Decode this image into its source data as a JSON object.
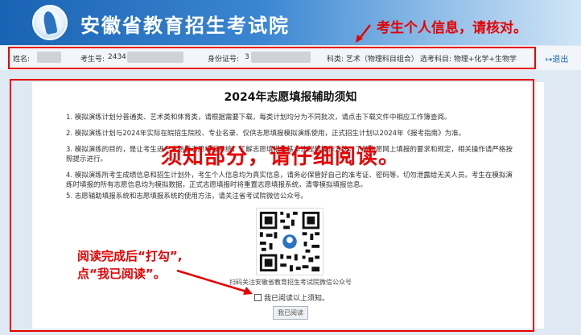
{
  "header": {
    "site_title": "安徽省教育招生考试院",
    "annotation": "考生个人信息，请核对。"
  },
  "info_bar": {
    "name_label": "姓名:",
    "exam_no_label": "考生号:",
    "exam_no_visible": "2434",
    "id_label": "身份证号:",
    "id_visible": "3",
    "category": "科类: 艺术（物理科目组合）",
    "subjects": "选考科目: 物理+化学+生物学",
    "logout": "退出"
  },
  "notice": {
    "title": "2024年志愿填报辅助须知",
    "paragraphs": [
      "1. 模拟演练计划分普通类、艺术类和体育类，请根据需要下载，每类计划均分为不同批次，请点击下载文件中相应工作簿查阅。",
      "2. 模拟演练计划与2024年实际在皖招生院校、专业名录、仅供志愿填报模拟演练使用，正式招生计划以2024年《报考指南》为准。",
      "3. 模拟演练的目的，是让考生进一步熟悉志愿填报系统，了解志愿填报的基本流程和操作方法，了解志愿网上填报的要求和规定，相关操作请严格按照提示进行。",
      "4. 模拟演练所考生成绩信息和招生计划外，考生个人信息均为真实信息，请务必保管好自己的准考证、密码等，切勿泄露给无关人员。考生在模拟演练时填报的所有志愿信息均为模拟数据，正式志愿填报时将重置志愿填报系统，清零模拟填报信息。",
      "5. 志愿辅助填报系统和志愿填报系统的使用方法，请关注省考试院微信公众号。"
    ],
    "annotation": "须知部分，请仔细阅读。",
    "qr_caption": "扫码关注安徽省教育招生考试院微信公众号",
    "agree_label": "我已阅读以上须知。",
    "read_button": "我已阅读"
  },
  "side_annotation": {
    "line1": "阅读完成后“打勾”,",
    "line2": "点“我已阅读”。"
  },
  "colors": {
    "header_blue": "#1a63b4",
    "annotation_red": "#e60000",
    "page_background": "#dfe9f3"
  }
}
